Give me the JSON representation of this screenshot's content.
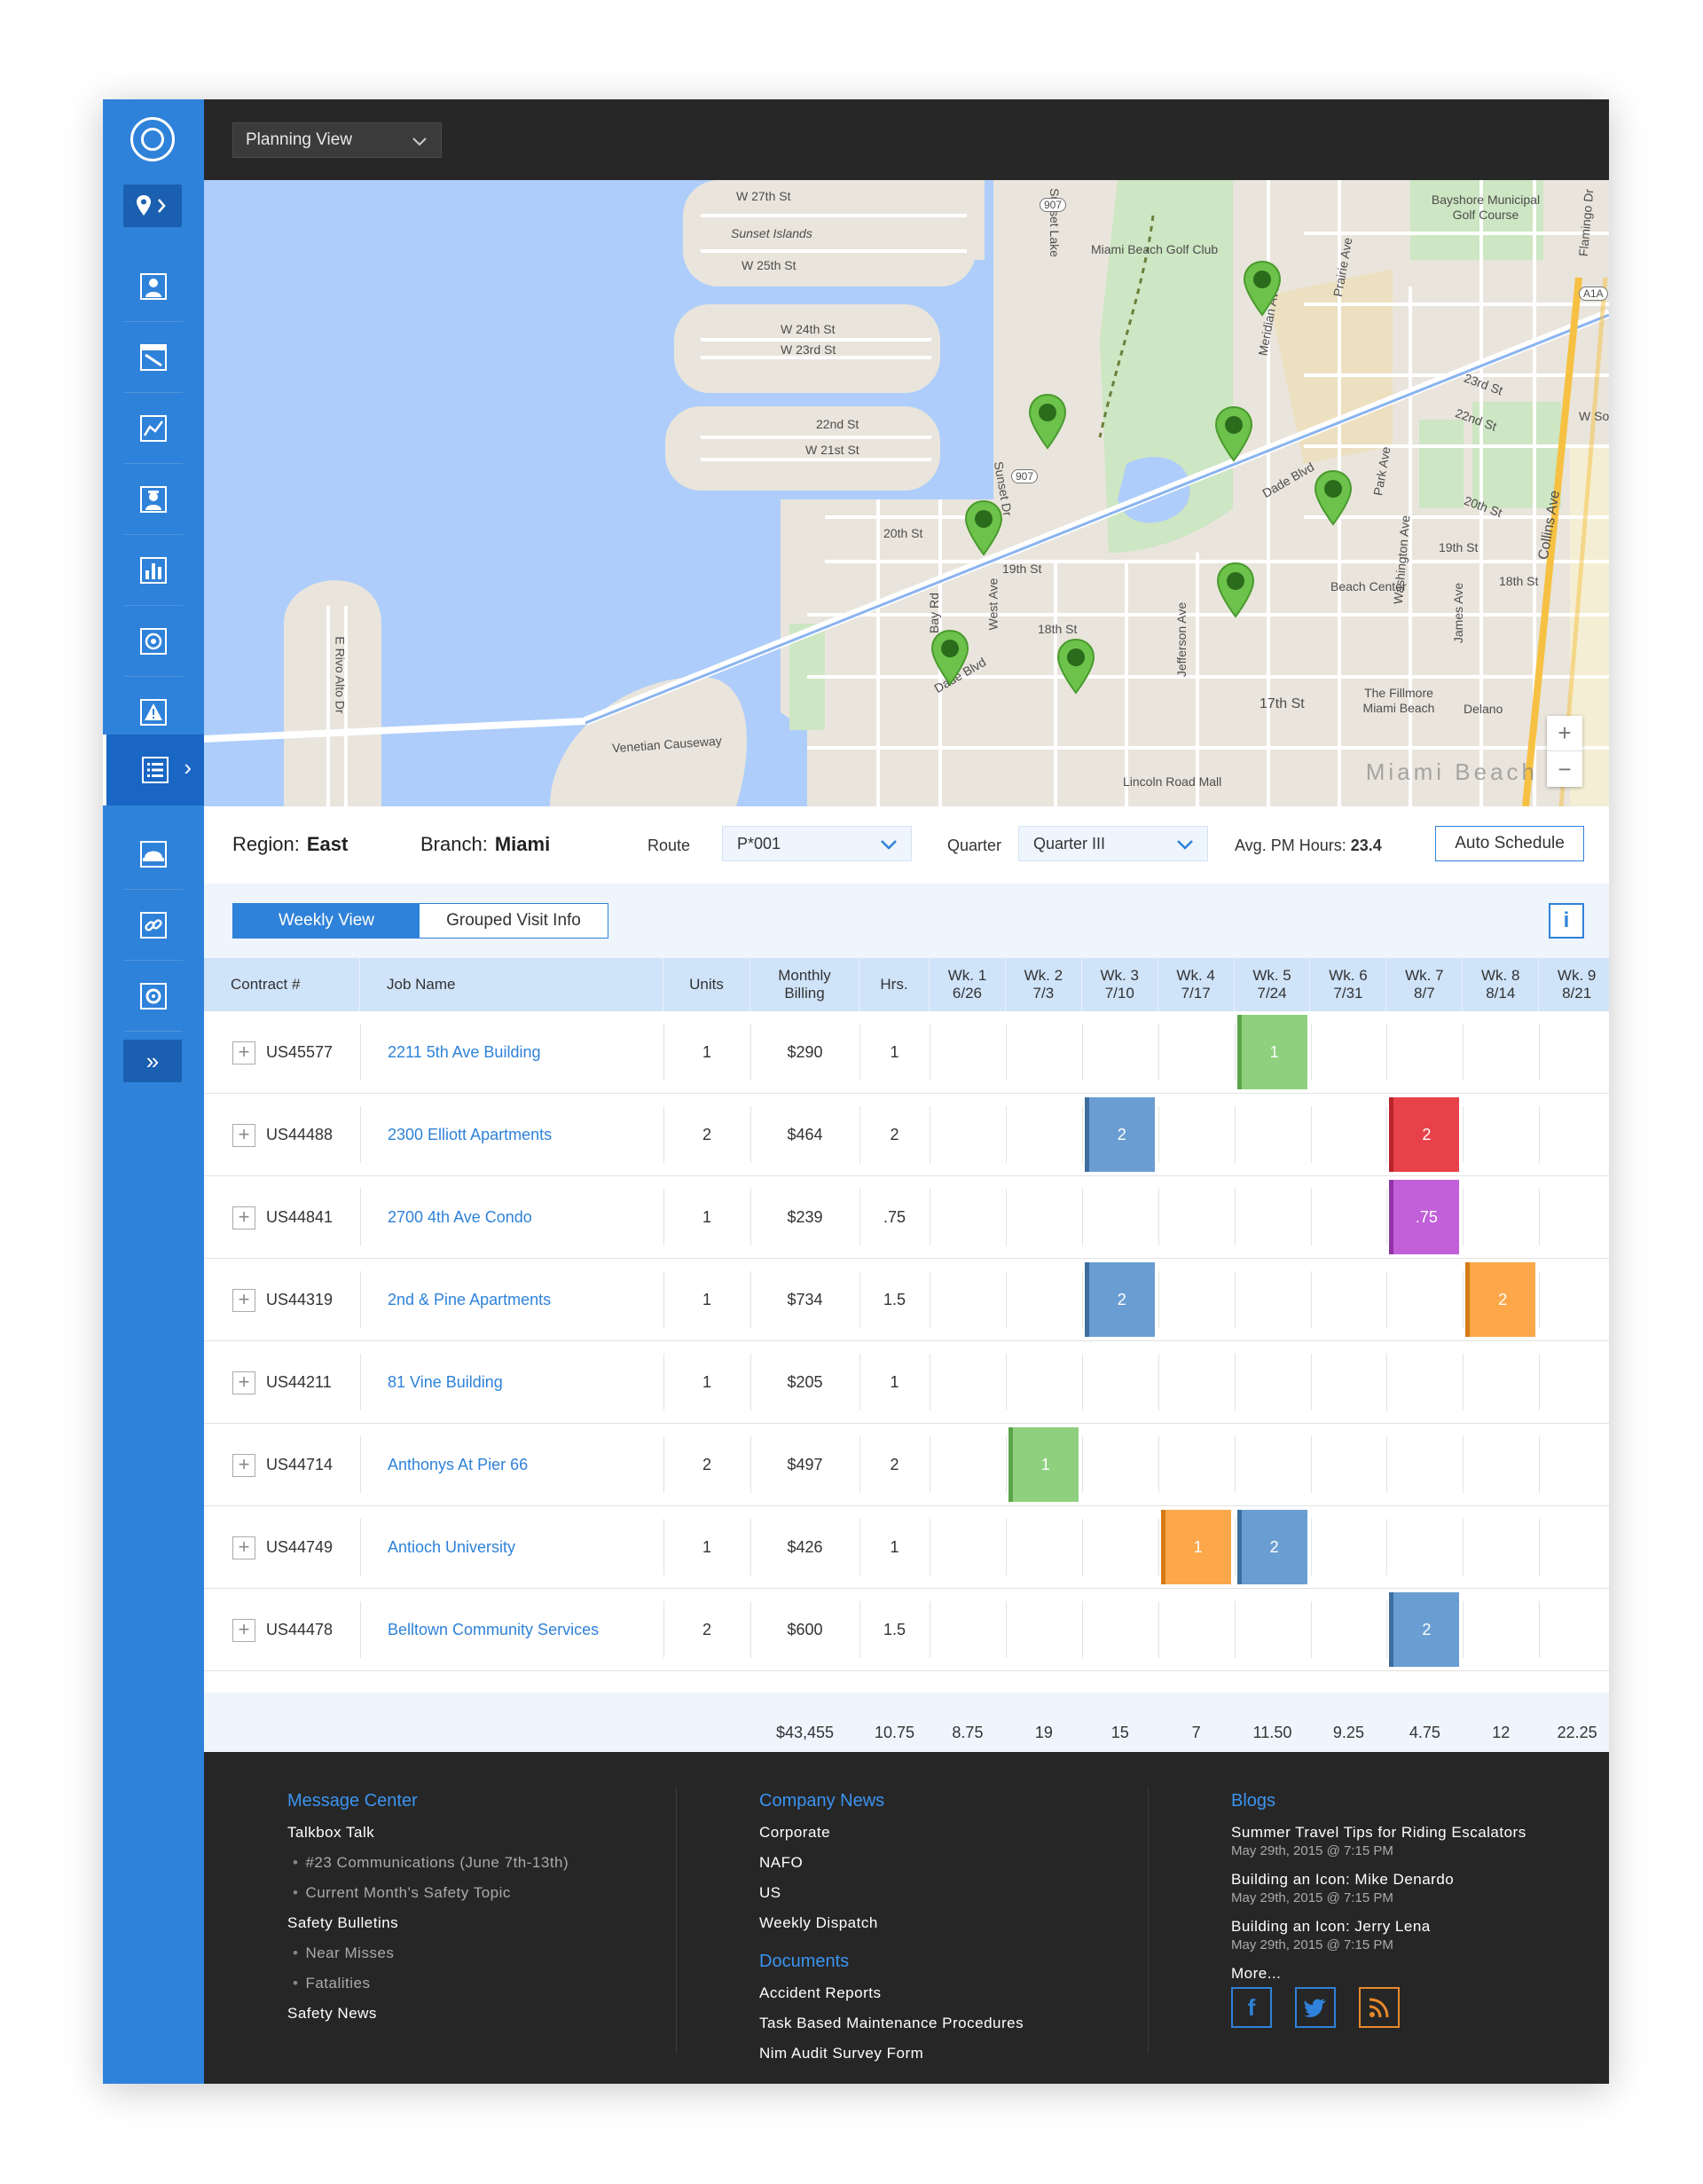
{
  "topbar": {
    "view_select": "Planning View"
  },
  "map": {
    "labels": {
      "w27": "W 27th St",
      "sunset": "Sunset Islands",
      "w25": "W 25th St",
      "w24": "W 24th St",
      "w23": "W 23rd St",
      "s22": "22nd St",
      "w21": "W 21st St",
      "s20": "20th St",
      "s19": "19th St",
      "s18": "18th St",
      "s17": "17th St",
      "golf": "Miami Beach Golf Club",
      "bayshore": "Bayshore Municipal Golf Course",
      "dade1": "Dade Blvd",
      "dade2": "Dade Blvd",
      "venetian": "Venetian Causeway",
      "lincoln": "Lincoln Road Mall",
      "fillmore": "The Fillmore Miami Beach",
      "delano": "Delano",
      "collins": "Collins Ave",
      "washington": "Washington Ave",
      "meridian": "Meridian Ave",
      "prairie": "Prairie Ave",
      "sunsetlake": "Sunset Lake",
      "sunsetdr": "Sunset Dr",
      "bayrd": "Bay Rd",
      "westave": "West Ave",
      "jefferson": "Jefferson Ave",
      "james": "James Ave",
      "flamingo": "Flamingo Dr",
      "wsou": "W Sou",
      "beachcenter": "Beach Center",
      "erivo": "E Rivo Alto Dr",
      "s23r": "23rd St",
      "s22r": "22nd St",
      "s20r": "20th St",
      "s19r": "19th St",
      "s18r": "18th St",
      "park": "Park Ave",
      "r907a": "907",
      "r907b": "907",
      "a1a": "A1A",
      "zoom_in": "+",
      "zoom_out": "−",
      "watermark": "Miami Beach"
    }
  },
  "filters": {
    "region_label": "Region:",
    "region_value": "East",
    "branch_label": "Branch:",
    "branch_value": "Miami",
    "route_label": "Route",
    "route_value": "P*001",
    "quarter_label": "Quarter",
    "quarter_value": "Quarter III",
    "avg_label": "Avg. PM Hours:",
    "avg_value": "23.4",
    "auto_schedule": "Auto Schedule"
  },
  "tabs": {
    "weekly": "Weekly View",
    "grouped": "Grouped Visit Info",
    "info": "i"
  },
  "table": {
    "headers": {
      "contract": "Contract #",
      "job": "Job Name",
      "units": "Units",
      "monthly1": "Monthly",
      "monthly2": "Billing",
      "hrs": "Hrs.",
      "weeks": [
        {
          "w": "Wk. 1",
          "d": "6/26"
        },
        {
          "w": "Wk. 2",
          "d": "7/3"
        },
        {
          "w": "Wk. 3",
          "d": "7/10"
        },
        {
          "w": "Wk. 4",
          "d": "7/17"
        },
        {
          "w": "Wk. 5",
          "d": "7/24"
        },
        {
          "w": "Wk. 6",
          "d": "7/31"
        },
        {
          "w": "Wk. 7",
          "d": "8/7"
        },
        {
          "w": "Wk. 8",
          "d": "8/14"
        },
        {
          "w": "Wk. 9",
          "d": "8/21"
        }
      ]
    },
    "rows": [
      {
        "contract": "US45577",
        "job": "2211 5th Ave Building",
        "units": "1",
        "billing": "$290",
        "hrs": "1"
      },
      {
        "contract": "US44488",
        "job": "2300 Elliott Apartments",
        "units": "2",
        "billing": "$464",
        "hrs": "2"
      },
      {
        "contract": "US44841",
        "job": "2700 4th Ave Condo",
        "units": "1",
        "billing": "$239",
        "hrs": ".75"
      },
      {
        "contract": "US44319",
        "job": "2nd & Pine Apartments",
        "units": "1",
        "billing": "$734",
        "hrs": "1.5"
      },
      {
        "contract": "US44211",
        "job": "81 Vine Building",
        "units": "1",
        "billing": "$205",
        "hrs": "1"
      },
      {
        "contract": "US44714",
        "job": "Anthonys At Pier 66",
        "units": "2",
        "billing": "$497",
        "hrs": "2"
      },
      {
        "contract": "US44749",
        "job": "Antioch University",
        "units": "1",
        "billing": "$426",
        "hrs": "1"
      },
      {
        "contract": "US44478",
        "job": "Belltown Community Services",
        "units": "2",
        "billing": "$600",
        "hrs": "1.5"
      }
    ],
    "blocks": [
      {
        "row": 0,
        "week": 5,
        "label": "1",
        "color": "#8ed07e",
        "edge": "#5aa54a"
      },
      {
        "row": 1,
        "week": 3,
        "label": "2",
        "color": "#6a9ed3",
        "edge": "#3d6e9e"
      },
      {
        "row": 1,
        "week": 7,
        "label": "2",
        "color": "#e8414a",
        "edge": "#b8242c"
      },
      {
        "row": 2,
        "week": 7,
        "label": ".75",
        "color": "#c160d8",
        "edge": "#9234a8"
      },
      {
        "row": 3,
        "week": 3,
        "label": "2",
        "color": "#6a9ed3",
        "edge": "#3d6e9e"
      },
      {
        "row": 3,
        "week": 8,
        "label": "2",
        "color": "#fba74a",
        "edge": "#d77b18"
      },
      {
        "row": 5,
        "week": 2,
        "label": "1",
        "color": "#8ed07e",
        "edge": "#5aa54a"
      },
      {
        "row": 6,
        "week": 4,
        "label": "1",
        "color": "#fba74a",
        "edge": "#d77b18"
      },
      {
        "row": 6,
        "week": 5,
        "label": "2",
        "color": "#6a9ed3",
        "edge": "#3d6e9e"
      },
      {
        "row": 7,
        "week": 7,
        "label": "2",
        "color": "#6a9ed3",
        "edge": "#3d6e9e"
      }
    ],
    "totals": {
      "billing": "$43,455",
      "hrs": "10.75",
      "weeks": [
        "8.75",
        "19",
        "15",
        "7",
        "11.50",
        "9.25",
        "4.75",
        "12",
        "22.25"
      ]
    }
  },
  "footer": {
    "message_center": {
      "title": "Message Center",
      "talkbox": "Talkbox Talk",
      "talkbox_items": [
        "#23 Communications (June 7th-13th)",
        "Current Month's Safety Topic"
      ],
      "bulletins": "Safety Bulletins",
      "bulletin_items": [
        "Near Misses",
        "Fatalities"
      ],
      "news": "Safety News"
    },
    "company_news": {
      "title": "Company News",
      "items": [
        "Corporate",
        "NAFO",
        "US",
        "Weekly Dispatch"
      ]
    },
    "documents": {
      "title": "Documents",
      "items": [
        "Accident Reports",
        "Task Based Maintenance Procedures",
        "Nim Audit Survey Form"
      ]
    },
    "blogs": {
      "title": "Blogs",
      "items": [
        {
          "title": "Summer Travel Tips for Riding Escalators",
          "date": "May 29th, 2015 @ 7:15 PM"
        },
        {
          "title": "Building an Icon: Mike Denardo",
          "date": "May 29th, 2015 @ 7:15 PM"
        },
        {
          "title": "Building an Icon: Jerry Lena",
          "date": "May 29th, 2015 @ 7:15 PM"
        }
      ],
      "more": "More..."
    },
    "social": {
      "facebook": "f",
      "twitter": "t",
      "rss": "rss"
    }
  }
}
